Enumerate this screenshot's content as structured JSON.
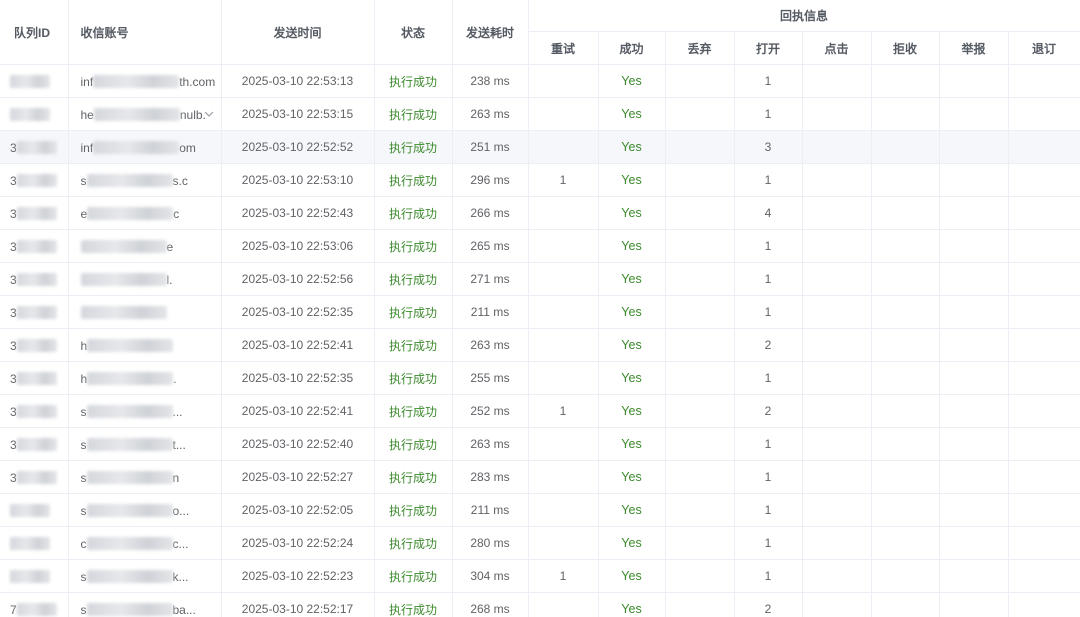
{
  "headers": {
    "queue_id": "队列ID",
    "account": "收信账号",
    "send_time": "发送时间",
    "status": "状态",
    "duration": "发送耗时",
    "receipt_group": "回执信息",
    "receipt": {
      "retry": "重试",
      "success": "成功",
      "discard": "丢弃",
      "open": "打开",
      "click": "点击",
      "reject": "拒收",
      "report": "举报",
      "unsubscribe": "退订"
    }
  },
  "rows": [
    {
      "id": "",
      "account_prefix": "inf",
      "account_suffix": "th.com",
      "time": "2025-03-10 22:53:13",
      "status": "执行成功",
      "duration": "238 ms",
      "retry": "",
      "success": "Yes",
      "discard": "",
      "open": "1",
      "click": "",
      "reject": "",
      "report": "",
      "unsub": ""
    },
    {
      "id": "",
      "account_prefix": "he",
      "account_suffix": "nulb.",
      "time": "2025-03-10 22:53:15",
      "status": "执行成功",
      "duration": "263 ms",
      "retry": "",
      "success": "Yes",
      "discard": "",
      "open": "1",
      "click": "",
      "reject": "",
      "report": "",
      "unsub": ""
    },
    {
      "id": "3",
      "account_prefix": "inf",
      "account_suffix": "om",
      "time": "2025-03-10 22:52:52",
      "status": "执行成功",
      "duration": "251 ms",
      "retry": "",
      "success": "Yes",
      "discard": "",
      "open": "3",
      "click": "",
      "reject": "",
      "report": "",
      "unsub": ""
    },
    {
      "id": "3",
      "account_prefix": "s",
      "account_suffix": "s.c",
      "time": "2025-03-10 22:53:10",
      "status": "执行成功",
      "duration": "296 ms",
      "retry": "1",
      "success": "Yes",
      "discard": "",
      "open": "1",
      "click": "",
      "reject": "",
      "report": "",
      "unsub": ""
    },
    {
      "id": "3",
      "account_prefix": "e",
      "account_suffix": "c",
      "time": "2025-03-10 22:52:43",
      "status": "执行成功",
      "duration": "266 ms",
      "retry": "",
      "success": "Yes",
      "discard": "",
      "open": "4",
      "click": "",
      "reject": "",
      "report": "",
      "unsub": ""
    },
    {
      "id": "3",
      "account_prefix": "",
      "account_suffix": "e",
      "time": "2025-03-10 22:53:06",
      "status": "执行成功",
      "duration": "265 ms",
      "retry": "",
      "success": "Yes",
      "discard": "",
      "open": "1",
      "click": "",
      "reject": "",
      "report": "",
      "unsub": ""
    },
    {
      "id": "3",
      "account_prefix": "",
      "account_suffix": "l.",
      "time": "2025-03-10 22:52:56",
      "status": "执行成功",
      "duration": "271 ms",
      "retry": "",
      "success": "Yes",
      "discard": "",
      "open": "1",
      "click": "",
      "reject": "",
      "report": "",
      "unsub": ""
    },
    {
      "id": "3",
      "account_prefix": "",
      "account_suffix": "",
      "time": "2025-03-10 22:52:35",
      "status": "执行成功",
      "duration": "211 ms",
      "retry": "",
      "success": "Yes",
      "discard": "",
      "open": "1",
      "click": "",
      "reject": "",
      "report": "",
      "unsub": ""
    },
    {
      "id": "3",
      "account_prefix": "h",
      "account_suffix": "",
      "time": "2025-03-10 22:52:41",
      "status": "执行成功",
      "duration": "263 ms",
      "retry": "",
      "success": "Yes",
      "discard": "",
      "open": "2",
      "click": "",
      "reject": "",
      "report": "",
      "unsub": ""
    },
    {
      "id": "3",
      "account_prefix": "h",
      "account_suffix": ".",
      "time": "2025-03-10 22:52:35",
      "status": "执行成功",
      "duration": "255 ms",
      "retry": "",
      "success": "Yes",
      "discard": "",
      "open": "1",
      "click": "",
      "reject": "",
      "report": "",
      "unsub": ""
    },
    {
      "id": "3",
      "account_prefix": "s",
      "account_suffix": "...",
      "time": "2025-03-10 22:52:41",
      "status": "执行成功",
      "duration": "252 ms",
      "retry": "1",
      "success": "Yes",
      "discard": "",
      "open": "2",
      "click": "",
      "reject": "",
      "report": "",
      "unsub": ""
    },
    {
      "id": "3",
      "account_prefix": "s",
      "account_suffix": "t...",
      "time": "2025-03-10 22:52:40",
      "status": "执行成功",
      "duration": "263 ms",
      "retry": "",
      "success": "Yes",
      "discard": "",
      "open": "1",
      "click": "",
      "reject": "",
      "report": "",
      "unsub": ""
    },
    {
      "id": "3",
      "account_prefix": "s",
      "account_suffix": "n",
      "time": "2025-03-10 22:52:27",
      "status": "执行成功",
      "duration": "283 ms",
      "retry": "",
      "success": "Yes",
      "discard": "",
      "open": "1",
      "click": "",
      "reject": "",
      "report": "",
      "unsub": ""
    },
    {
      "id": "",
      "account_prefix": "s",
      "account_suffix": "o...",
      "time": "2025-03-10 22:52:05",
      "status": "执行成功",
      "duration": "211 ms",
      "retry": "",
      "success": "Yes",
      "discard": "",
      "open": "1",
      "click": "",
      "reject": "",
      "report": "",
      "unsub": ""
    },
    {
      "id": "",
      "account_prefix": "c",
      "account_suffix": "c...",
      "time": "2025-03-10 22:52:24",
      "status": "执行成功",
      "duration": "280 ms",
      "retry": "",
      "success": "Yes",
      "discard": "",
      "open": "1",
      "click": "",
      "reject": "",
      "report": "",
      "unsub": ""
    },
    {
      "id": "",
      "account_prefix": "s",
      "account_suffix": "k...",
      "time": "2025-03-10 22:52:23",
      "status": "执行成功",
      "duration": "304 ms",
      "retry": "1",
      "success": "Yes",
      "discard": "",
      "open": "1",
      "click": "",
      "reject": "",
      "report": "",
      "unsub": ""
    },
    {
      "id": "7",
      "account_prefix": "s",
      "account_suffix": "ba...",
      "time": "2025-03-10 22:52:17",
      "status": "执行成功",
      "duration": "268 ms",
      "retry": "",
      "success": "Yes",
      "discard": "",
      "open": "2",
      "click": "",
      "reject": "",
      "report": "",
      "unsub": ""
    }
  ]
}
